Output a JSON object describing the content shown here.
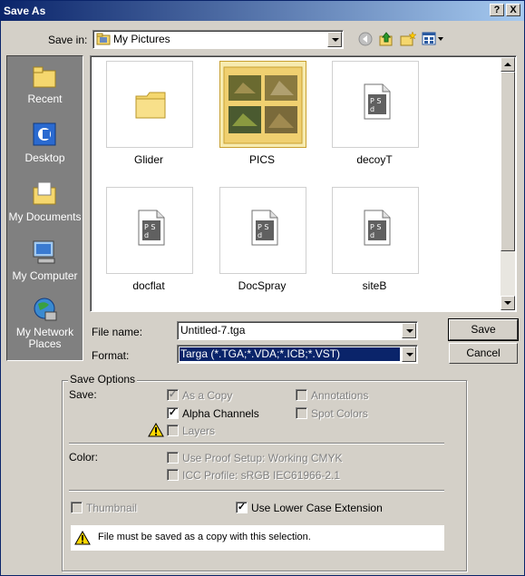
{
  "window": {
    "title": "Save As",
    "help_label": "?",
    "close_label": "X"
  },
  "save_in": {
    "label": "Save in:",
    "value": "My Pictures"
  },
  "places": [
    {
      "label": "Recent"
    },
    {
      "label": "Desktop"
    },
    {
      "label": "My Documents"
    },
    {
      "label": "My Computer"
    },
    {
      "label": "My Network\nPlaces"
    }
  ],
  "files": [
    {
      "name": "Glider",
      "type": "folder"
    },
    {
      "name": "PICS",
      "type": "folder-thumbnails",
      "selected": true
    },
    {
      "name": "decoyT",
      "type": "psd"
    },
    {
      "name": "docflat",
      "type": "psd"
    },
    {
      "name": "DocSpray",
      "type": "psd"
    },
    {
      "name": "siteB",
      "type": "psd"
    }
  ],
  "file_name": {
    "label": "File name:",
    "value": "Untitled-7.tga"
  },
  "format": {
    "label": "Format:",
    "value": "Targa (*.TGA;*.VDA;*.ICB;*.VST)"
  },
  "buttons": {
    "save": "Save",
    "cancel": "Cancel"
  },
  "save_options": {
    "legend": "Save Options",
    "save_label": "Save:",
    "as_a_copy": {
      "label": "As a Copy",
      "checked": true,
      "enabled": false
    },
    "alpha_channels": {
      "label": "Alpha Channels",
      "checked": true,
      "enabled": true
    },
    "layers": {
      "label": "Layers",
      "checked": false,
      "enabled": false
    },
    "annotations": {
      "label": "Annotations",
      "checked": false,
      "enabled": false
    },
    "spot_colors": {
      "label": "Spot Colors",
      "checked": false,
      "enabled": false
    },
    "color_label": "Color:",
    "use_proof_setup": {
      "label": "Use Proof Setup:  Working CMYK",
      "checked": false,
      "enabled": false
    },
    "icc_profile": {
      "label": "ICC Profile:  sRGB IEC61966-2.1",
      "checked": false,
      "enabled": false
    },
    "thumbnail": {
      "label": "Thumbnail",
      "checked": false,
      "enabled": false
    },
    "lower_case_extension": {
      "label": "Use Lower Case Extension",
      "checked": true,
      "enabled": true
    },
    "warning": "File must be saved as a copy with this selection."
  },
  "colors": {
    "title_bar": "#0a246a",
    "face": "#d4d0c8",
    "selection": "#0a246a",
    "folder": "#f5d76e"
  }
}
